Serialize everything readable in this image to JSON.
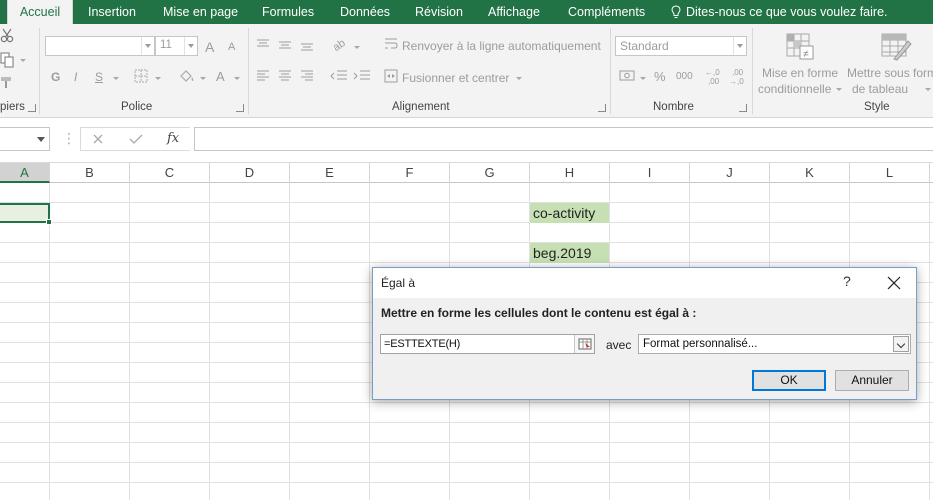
{
  "ribbon_tabs": {
    "items": [
      "Accueil",
      "Insertion",
      "Mise en page",
      "Formules",
      "Données",
      "Révision",
      "Affichage",
      "Compléments"
    ],
    "active": "Accueil",
    "tell_me": "Dites-nous ce que vous voulez faire."
  },
  "ribbon": {
    "clipboard": {
      "label": "piers"
    },
    "font": {
      "label": "Police",
      "size": "11",
      "bold": "G",
      "italic": "I",
      "underline": "S",
      "grow": "A",
      "shrink": "A",
      "color": "A"
    },
    "alignment": {
      "label": "Alignement",
      "wrap_text": "Renvoyer à la ligne automatiquement",
      "merge_center": "Fusionner et centrer"
    },
    "number": {
      "label": "Nombre",
      "format": "Standard",
      "percent": "%",
      "thousands": "000",
      "inc_decimals": "←,0\n,00",
      "dec_decimals": ",00\n→,0"
    },
    "styles": {
      "label": "Style",
      "conditional_line1": "Mise en forme",
      "conditional_line2": "conditionnelle",
      "table_line1": "Mettre sous form",
      "table_line2": "de tableau"
    }
  },
  "formula_bar": {
    "name_box": "",
    "fx": "fx",
    "formula": ""
  },
  "grid": {
    "columns": [
      "A",
      "B",
      "C",
      "D",
      "E",
      "F",
      "G",
      "H",
      "I",
      "J",
      "K",
      "L"
    ],
    "selected_column": "A",
    "cells": [
      {
        "ref": "H2",
        "value": "co-activity"
      },
      {
        "ref": "H4",
        "value": "beg.2019"
      }
    ],
    "highlight_color": "#c6e0b4"
  },
  "dialog": {
    "title": "Égal à",
    "help": "?",
    "prompt": "Mettre en forme les cellules dont le contenu est égal à :",
    "value": "=ESTTEXTE(H)",
    "with_label": "avec",
    "format": "Format personnalisé...",
    "ok": "OK",
    "cancel": "Annuler"
  },
  "colors": {
    "excel_green": "#217346",
    "ribbon_bg": "#f3f3f3"
  }
}
